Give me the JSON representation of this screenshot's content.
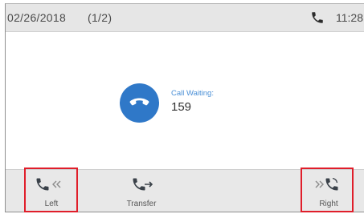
{
  "status_bar": {
    "date": "02/26/2018",
    "page_indicator": "(1/2)",
    "time": "11:28",
    "phone_icon": "phone-icon"
  },
  "call": {
    "avatar_icon": "hang-up-icon",
    "avatar_color": "#2f78c8",
    "label": "Call Waiting:",
    "number": "159"
  },
  "softkeys": [
    {
      "label": "Left",
      "icon": "phone-left-arrow-icon"
    },
    {
      "label": "Transfer",
      "icon": "phone-transfer-icon"
    },
    {
      "label": "Right",
      "icon": "phone-right-arrow-icon"
    }
  ],
  "colors": {
    "accent": "#2f78c8",
    "highlight": "#e01e2a",
    "key_icon": "#3a4149"
  }
}
